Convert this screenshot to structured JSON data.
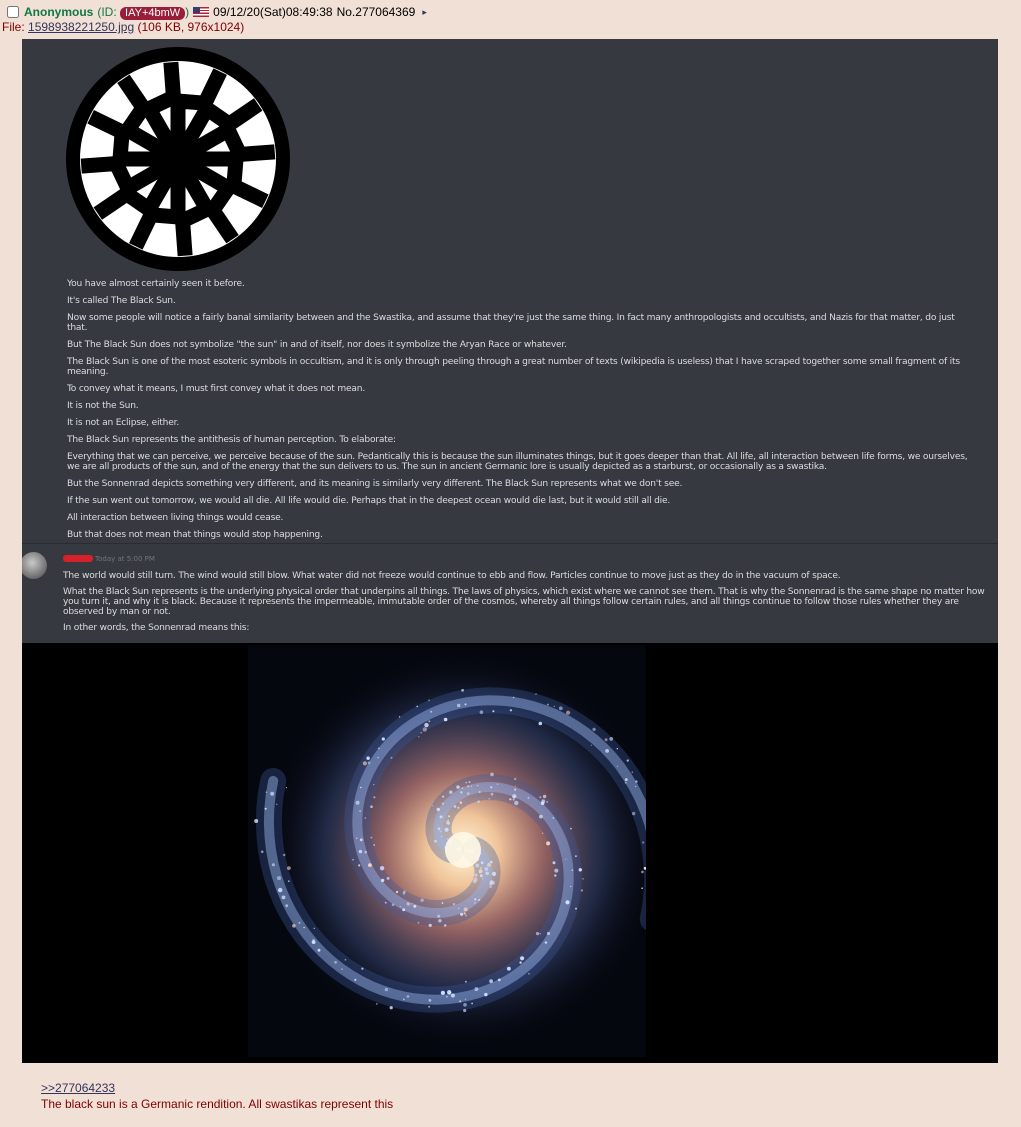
{
  "post": {
    "name": "Anonymous",
    "id_prefix": "(ID:",
    "id": "IAY+4bmW",
    "id_suffix": ")",
    "datetime": "09/12/20(Sat)08:49:38",
    "number": "No.277064369",
    "menu_arrow": "▸",
    "file_label": "File:",
    "file_name": "1598938221250.jpg",
    "file_info": "(106 KB, 976x1024)"
  },
  "attachment": {
    "message1": [
      "You have almost certainly seen it before.",
      "It's called The Black Sun.",
      "Now some people will notice a fairly banal similarity between and the Swastika, and assume that they're just the same thing. In fact many anthropologists and occultists, and Nazis for that matter, do just that.",
      "But The Black Sun does not symbolize \"the sun\" in and of itself, nor does it symbolize the Aryan Race or whatever.",
      "The Black Sun is one of the most esoteric symbols in occultism, and it is only through peeling through a great number of texts (wikipedia is useless) that I have scraped together some small fragment of its meaning.",
      "To convey what it means, I must first convey what it does not mean.",
      "It is not the Sun.",
      "It is not an Eclipse, either.",
      "The Black Sun represents the antithesis of human perception. To elaborate:",
      "Everything that we can perceive, we perceive because of the sun. Pedantically this is because the sun illuminates things, but it goes deeper than that. All life, all interaction between life forms, we ourselves, we are all products of the sun, and of the energy that the sun delivers to us. The sun in ancient Germanic lore is usually depicted as a starburst, or occasionally as a swastika.",
      "But the Sonnenrad depicts something very different, and its meaning is similarly very different. The Black Sun represents what we don't see.",
      "If the sun went out tomorrow, we would all die. All life would die. Perhaps that in the deepest ocean would die last, but it would still all die.",
      "All interaction between living things would cease.",
      "But that does not mean that things would stop happening."
    ],
    "timestamp": "Today at 5:00 PM",
    "message2": [
      "The world would still turn. The wind would still blow. What water did not freeze would continue to ebb and flow. Particles continue to move just as they do in the vacuum of space.",
      "What the Black Sun represents is the underlying physical order that underpins all things. The laws of physics, which exist where we cannot see them. That is why the Sonnenrad is the same shape no matter how you turn it, and why it is black. Because it represents the impermeable, immutable order of the cosmos, whereby all things follow certain rules, and all things continue to follow those rules whether they are observed by man or not.",
      "In other words, the Sonnenrad means this:"
    ]
  },
  "reply": {
    "quote": ">>277064233",
    "text": "The black sun is a Germanic rendition. All swastikas represent this"
  },
  "colors": {
    "page_bg": "#f0e0d6",
    "name": "#117743",
    "link": "#34345c",
    "text": "#800000",
    "id_pill": "#9a1d39",
    "discord_bg": "#36393f"
  }
}
